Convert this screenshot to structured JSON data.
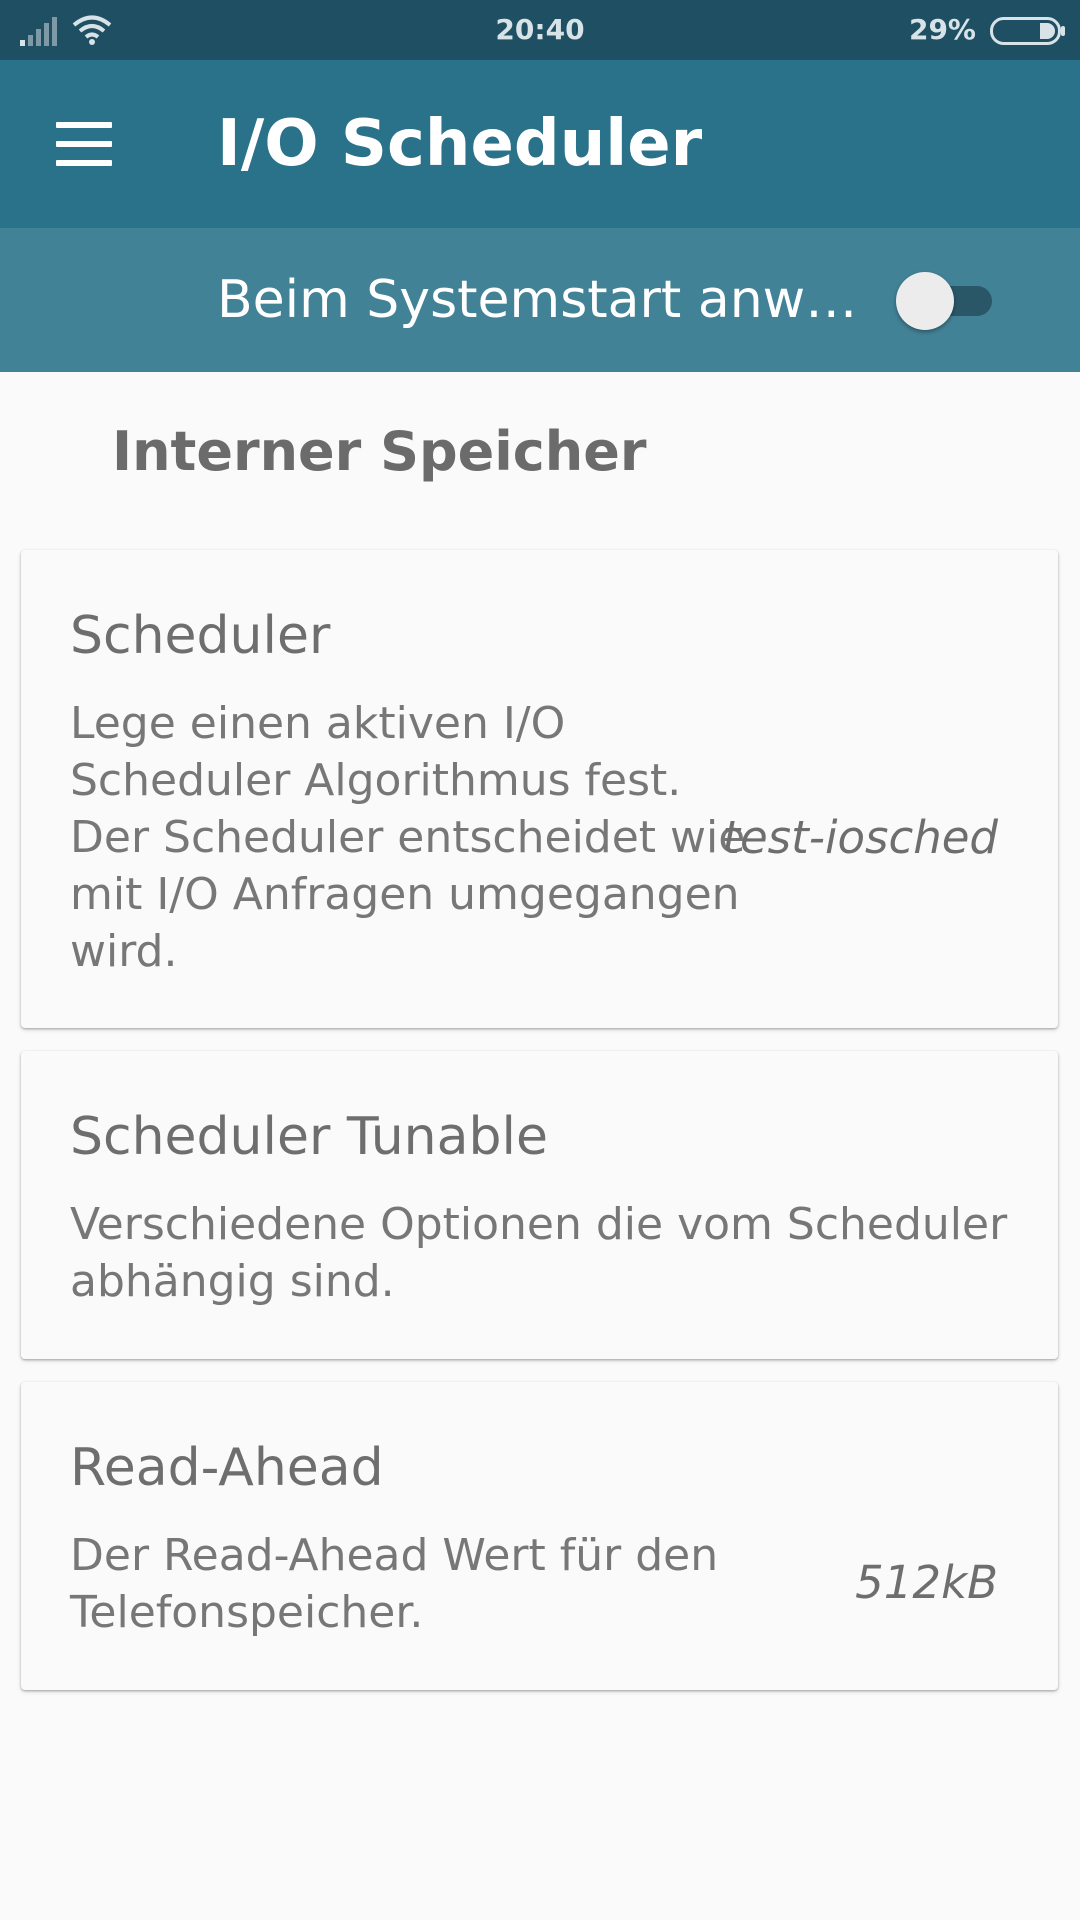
{
  "status_bar": {
    "time": "20:40",
    "battery_percent": "29%",
    "signal_icon": "signal-icon",
    "wifi_icon": "wifi-icon",
    "battery_icon": "battery-icon",
    "battery_level": 0.29
  },
  "toolbar": {
    "menu_icon": "menu-icon",
    "title": "I/O Scheduler",
    "color": "#2a7289"
  },
  "boot": {
    "label": "Beim Systemstart anwe…",
    "switch_on": false,
    "color": "#428297"
  },
  "section": {
    "title": "Interner Speicher"
  },
  "cards": [
    {
      "title": "Scheduler",
      "description_lines": [
        "Lege einen aktiven I/O",
        "Scheduler Algorithmus fest.",
        "Der Scheduler entscheidet wie",
        "mit I/O Anfragen umgegangen",
        "wird."
      ],
      "value": "test-iosched"
    },
    {
      "title": "Scheduler Tunable",
      "description_lines": [
        "Verschiedene Optionen die vom Scheduler",
        "abhängig sind."
      ],
      "value": ""
    },
    {
      "title": "Read-Ahead",
      "description_lines": [
        "Der Read-Ahead Wert für den",
        "Telefonspeicher."
      ],
      "value": "512kB"
    }
  ]
}
